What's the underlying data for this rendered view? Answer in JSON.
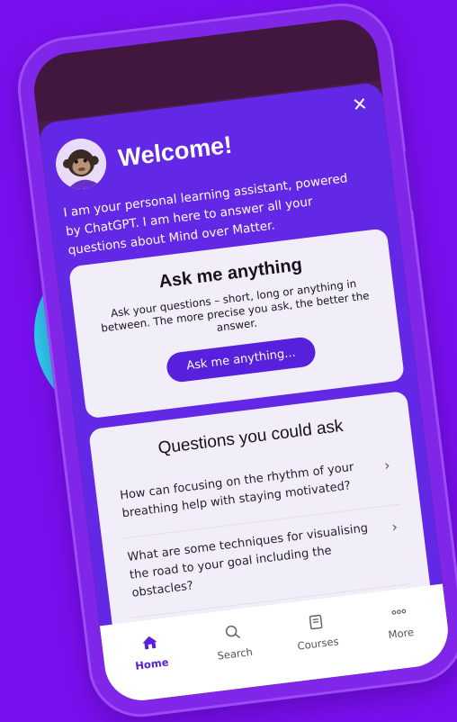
{
  "header": {
    "close_glyph": "✕",
    "title": "Welcome!",
    "intro": "I am your personal learning assistant, powered by ChatGPT. I am here to answer all your questions about Mind over Matter.",
    "avatar_icon": "monkey-avatar-icon"
  },
  "ask_card": {
    "title": "Ask me anything",
    "description": "Ask your questions – short, long or anything in between. The more precise you ask, the better the answer.",
    "button_label": "Ask me anything..."
  },
  "questions_card": {
    "title": "Questions you could ask",
    "items": [
      {
        "text": "How can focusing on the rhythm of your breathing help with staying motivated?"
      },
      {
        "text": "What are some techniques for visualising the road to your goal including the obstacles?"
      }
    ],
    "chevron": "›"
  },
  "tabs": [
    {
      "label": "Home",
      "icon": "home-icon",
      "active": true
    },
    {
      "label": "Search",
      "icon": "search-icon",
      "active": false
    },
    {
      "label": "Courses",
      "icon": "courses-icon",
      "active": false
    },
    {
      "label": "More",
      "icon": "more-icon",
      "active": false
    }
  ],
  "colors": {
    "background": "#7a0fef",
    "accent": "#5720dc",
    "ring": "#2fd2f2",
    "sheet": "#6327e6"
  }
}
